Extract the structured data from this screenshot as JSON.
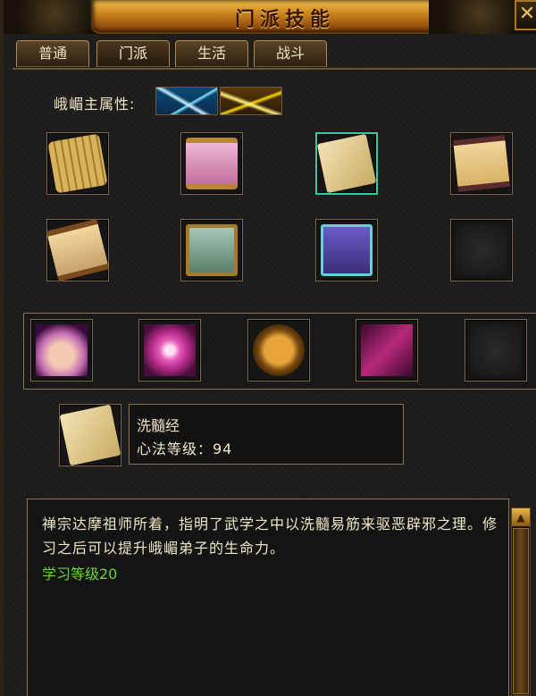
{
  "window": {
    "title": "门派技能",
    "close_label": "✕"
  },
  "tabs": [
    {
      "label": "普通"
    },
    {
      "label": "门派"
    },
    {
      "label": "生活"
    },
    {
      "label": "战斗"
    }
  ],
  "sect_attribute": {
    "label": "峨嵋主属性:",
    "icons": [
      "ice-attribute-icon",
      "thunder-attribute-icon"
    ]
  },
  "skill_grid": {
    "rows": [
      [
        "bamboo-scroll-icon",
        "pink-scroll-icon",
        "paper-book-icon",
        "figure-scroll-icon"
      ],
      [
        "calligraphy-scroll-icon",
        "boxed-book-icon",
        "gift-book-icon",
        "empty-slot"
      ]
    ],
    "selected": "paper-book-icon"
  },
  "combat_skills": [
    "palm-icon",
    "hand-ring-icon",
    "tortoise-shell-icon",
    "needle-icon",
    "empty-slot"
  ],
  "selected_skill": {
    "name": "洗髓经",
    "level_text": "心法等级：94",
    "icon": "paper-book-icon"
  },
  "description": {
    "text": "禅宗达摩祖师所着，指明了武学之中以洗髓易筋来驱恶辟邪之理。修习之后可以提升峨嵋弟子的生命力。",
    "requirement": "学习等级20",
    "requirement_color": "#6ad23a"
  }
}
